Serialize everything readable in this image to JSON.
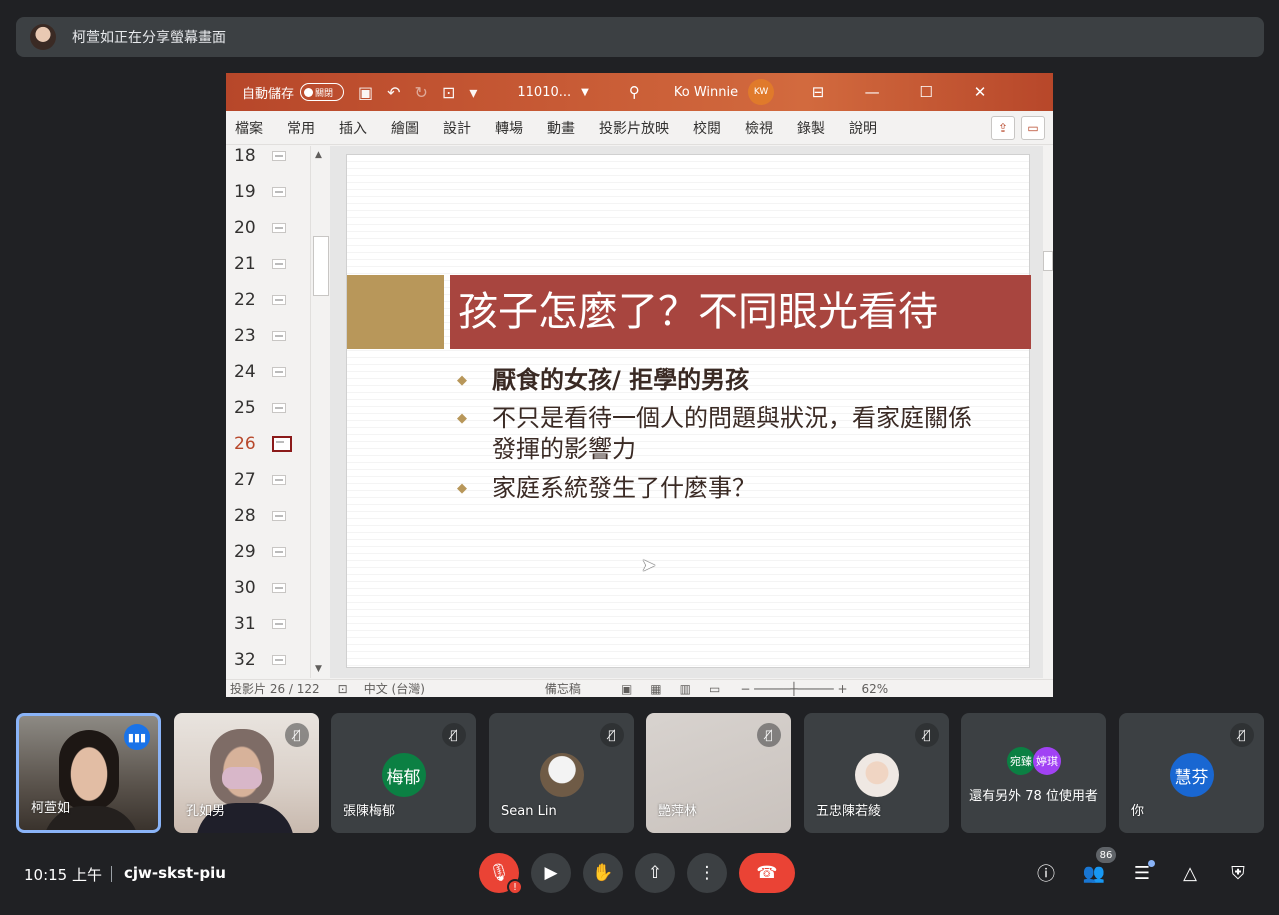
{
  "banner": {
    "text": "柯萱如正在分享螢幕畫面"
  },
  "ppt": {
    "autosave_label": "自動儲存",
    "autosave_state": "關閉",
    "doc_name": "11010...",
    "user_name": "Ko Winnie",
    "user_initials": "KW",
    "menu": [
      "檔案",
      "常用",
      "插入",
      "繪圖",
      "設計",
      "轉場",
      "動畫",
      "投影片放映",
      "校閱",
      "檢視",
      "錄製",
      "說明"
    ],
    "slide_numbers": [
      "18",
      "19",
      "20",
      "21",
      "22",
      "23",
      "24",
      "25",
      "26",
      "27",
      "28",
      "29",
      "30",
      "31",
      "32"
    ],
    "active_slide": "26",
    "slide": {
      "title": "孩子怎麼了？不同眼光看待",
      "bullets": [
        "厭食的女孩/ 拒學的男孩",
        "不只是看待一個人的問題與狀況，看家庭關係發揮的影響力",
        "家庭系統發生了什麼事？"
      ]
    },
    "status": {
      "slide_counter": "投影片 26 / 122",
      "language": "中文 (台灣)",
      "notes": "備忘稿",
      "zoom": "62%"
    },
    "colors": {
      "title_bar": "#b7472a",
      "slide_title_bg": "#a8453f",
      "accent": "#b8975a"
    }
  },
  "participants": [
    {
      "name": "柯萱如",
      "kind": "video",
      "speaking": true
    },
    {
      "name": "孔如男",
      "kind": "video",
      "muted": true
    },
    {
      "name": "張陳梅郁",
      "kind": "avatar",
      "initials": "梅郁",
      "color": "#0b8043",
      "muted": true
    },
    {
      "name": "Sean Lin",
      "kind": "photo",
      "muted": true
    },
    {
      "name": "艷萍林",
      "kind": "video",
      "muted": true
    },
    {
      "name": "五忠陳若綾",
      "kind": "photo",
      "muted": true
    },
    {
      "name": "還有另外 78 位使用者",
      "kind": "more",
      "chips": [
        "宛臻",
        "婷琪"
      ],
      "chip_colors": [
        "#0b8043",
        "#a142f4"
      ]
    },
    {
      "name": "你",
      "kind": "avatar",
      "initials": "慧芬",
      "color": "#1967d2",
      "muted": true
    }
  ],
  "bottom": {
    "time": "10:15 上午",
    "meeting_code": "cjw-skst-piu",
    "people_count": "86"
  }
}
